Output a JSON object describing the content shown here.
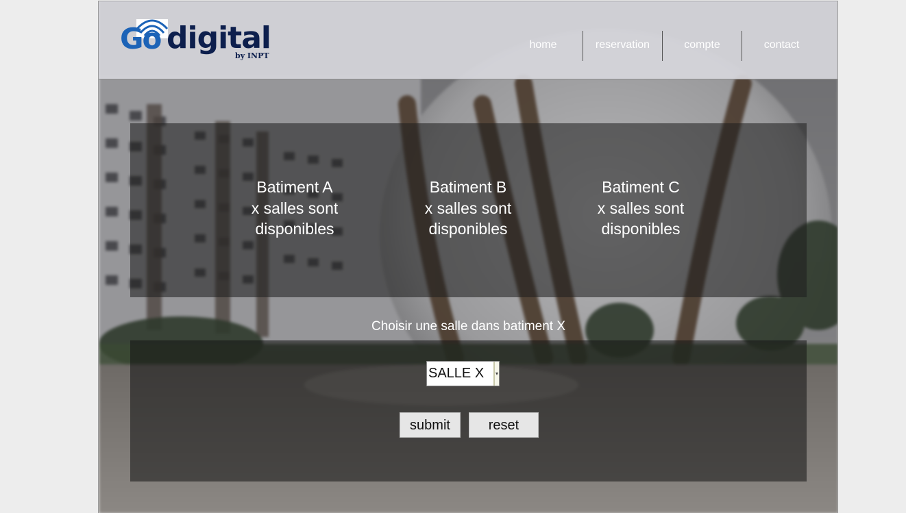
{
  "header": {
    "logo": {
      "go": "Go",
      "digital": "digital",
      "by": "by INPT"
    },
    "nav": [
      {
        "label": "home"
      },
      {
        "label": "reservation"
      },
      {
        "label": "compte"
      },
      {
        "label": "contact"
      }
    ]
  },
  "buildings": [
    {
      "name": "Batiment A",
      "line2": "x salles sont",
      "line3": "disponibles"
    },
    {
      "name": "Batiment B",
      "line2": "x salles sont",
      "line3": "disponibles"
    },
    {
      "name": "Batiment C",
      "line2": "x salles sont",
      "line3": "disponibles"
    }
  ],
  "form": {
    "title": "Choisir une salle dans batiment X",
    "select_value": "SALLE X",
    "submit_label": "submit",
    "reset_label": "reset"
  },
  "colors": {
    "page_bg": "#ededed",
    "header_bg": "#d6d6db",
    "logo_blue": "#1c63b7",
    "logo_navy": "#0d1f4d",
    "text_light": "#ffffff"
  }
}
